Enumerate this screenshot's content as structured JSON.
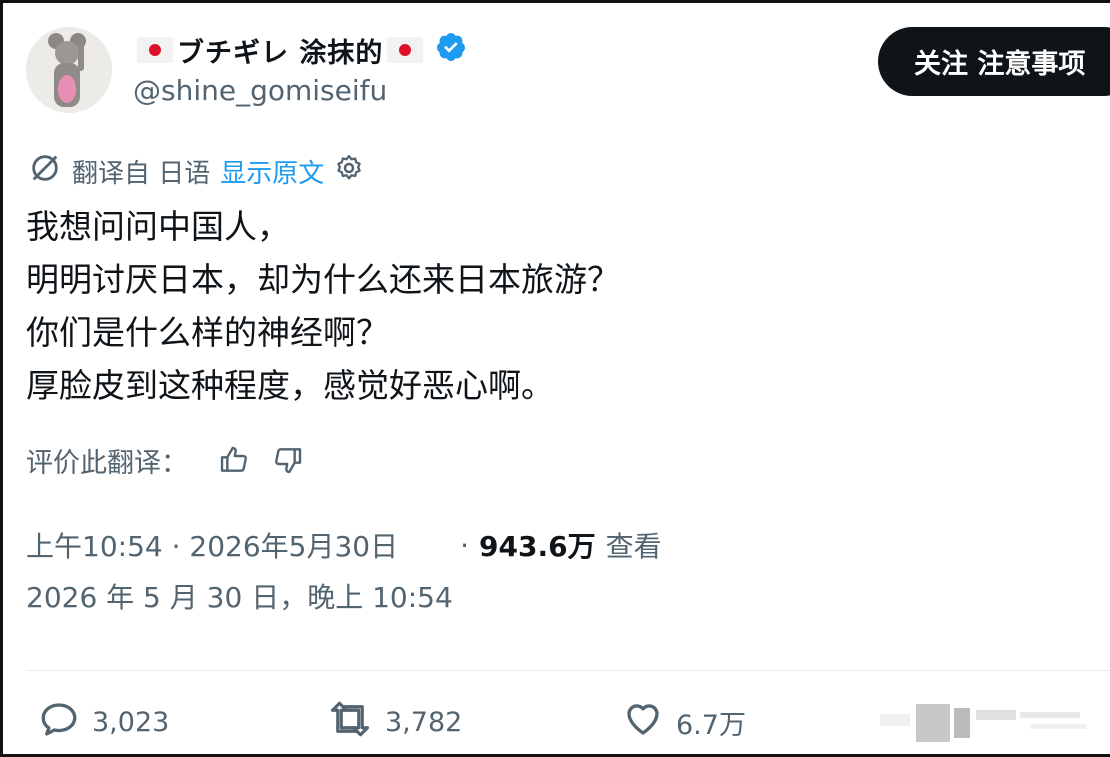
{
  "author": {
    "display_name": "ブチギレ 涂抹的",
    "handle": "@shine_gomiseifu",
    "flag_icon": "japan-flag-icon",
    "verified_icon": "verified-badge-icon",
    "verified_color": "#1d9bf0"
  },
  "follow_button": {
    "label": "关注 注意事项"
  },
  "translation": {
    "label": "翻译自 日语",
    "show_original": "显示原文",
    "icon": "translate-icon",
    "settings_icon": "gear-icon"
  },
  "tweet": {
    "lines": [
      "我想问问中国人，",
      "明明讨厌日本，却为什么还来日本旅游？",
      "你们是什么样的神经啊？",
      "厚脸皮到这种程度，感觉好恶心啊。"
    ]
  },
  "rate_translation": {
    "label": "评价此翻译："
  },
  "meta": {
    "time_date": "上午10:54 · 2026年5月30日",
    "dot": "·",
    "views_count": "943.6万",
    "views_label": "查看",
    "date_alt": "2026 年 5 月 30 日，晚上 10:54"
  },
  "actions": {
    "reply_count": "3,023",
    "retweet_count": "3,782",
    "like_count": "6.7万"
  },
  "colors": {
    "text": "#0f1419",
    "secondary": "#536471",
    "accent": "#1d9bf0",
    "button_bg": "#0f1419"
  }
}
